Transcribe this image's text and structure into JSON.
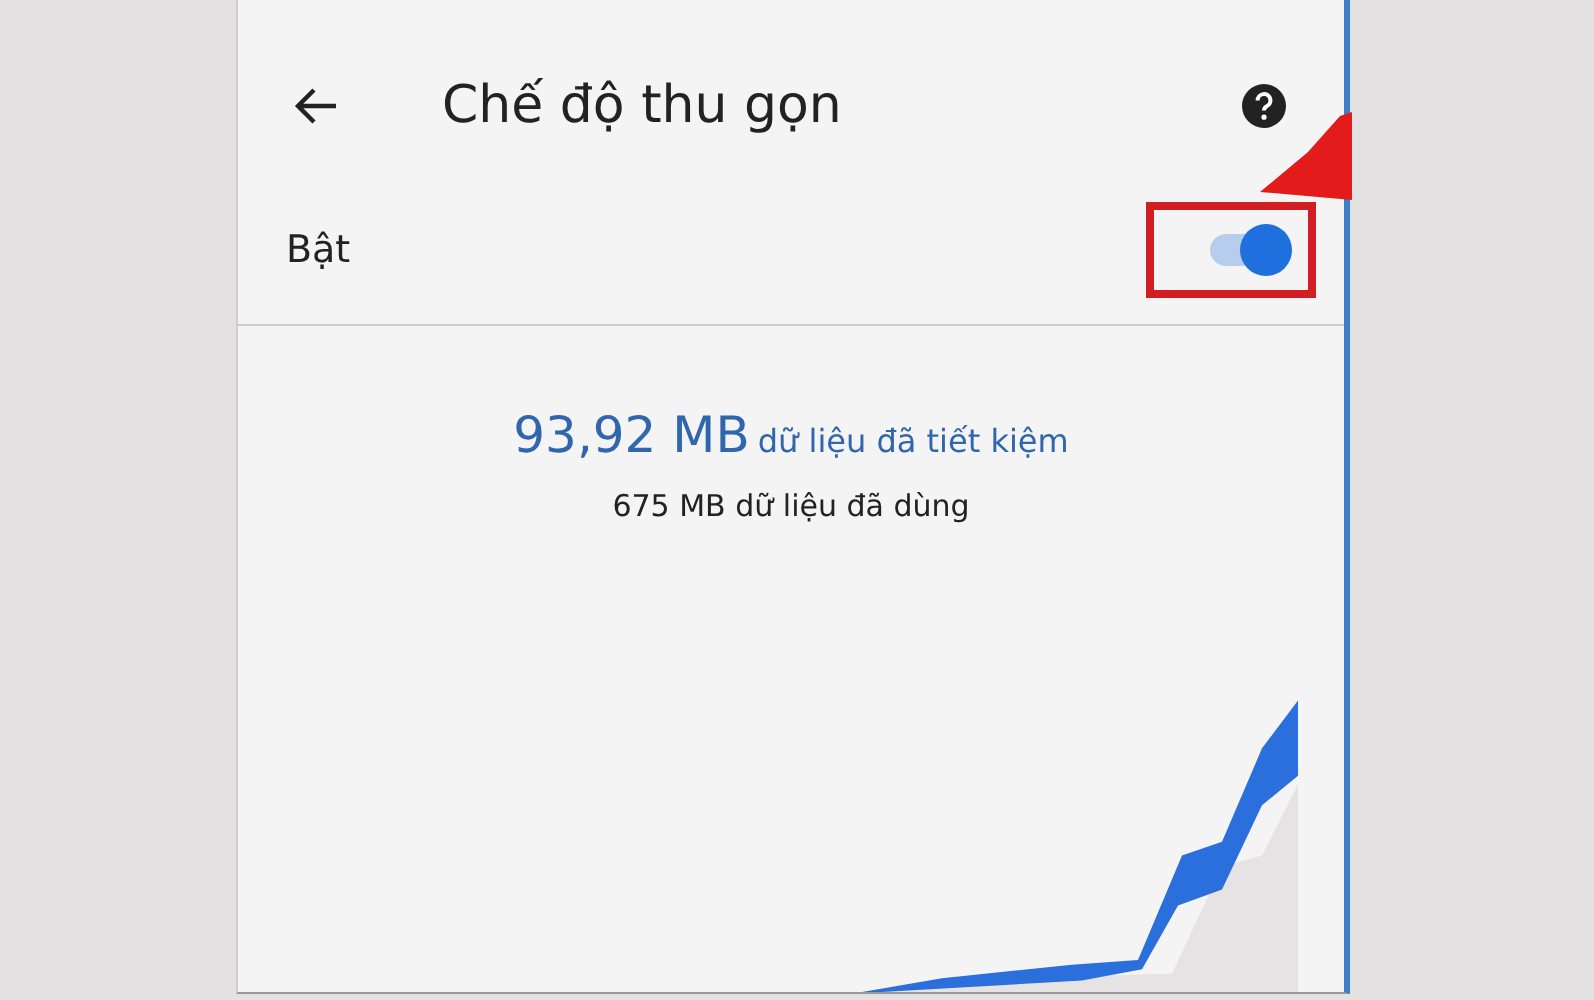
{
  "header": {
    "title": "Chế độ thu gọn"
  },
  "setting": {
    "label": "Bật",
    "on": true
  },
  "stats": {
    "saved_amount": "93,92 MB",
    "saved_label": "dữ liệu đã tiết kiệm",
    "used": "675 MB dữ liệu đã dùng"
  }
}
